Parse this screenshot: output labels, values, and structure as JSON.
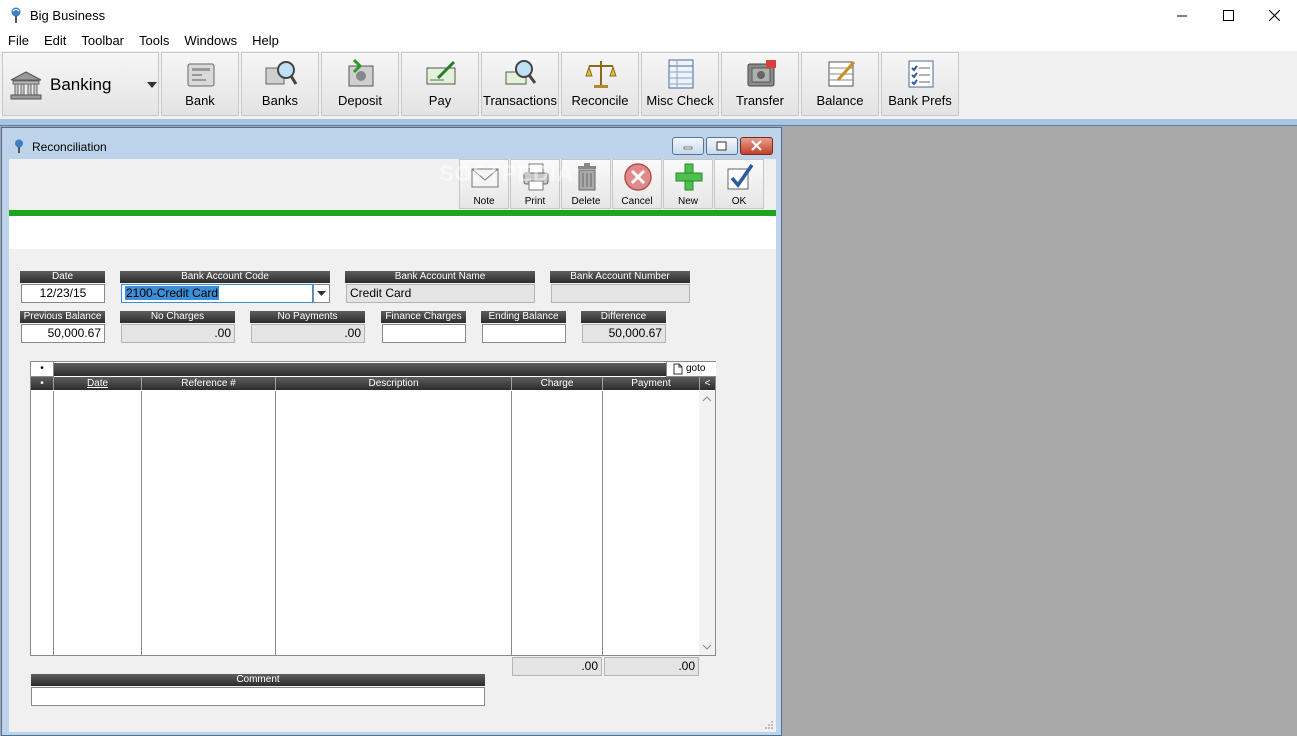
{
  "app": {
    "title": "Big Business"
  },
  "menu": [
    "File",
    "Edit",
    "Toolbar",
    "Tools",
    "Windows",
    "Help"
  ],
  "module": {
    "label": "Banking"
  },
  "toolbar": [
    {
      "label": "Bank",
      "icon": "bank-register-icon"
    },
    {
      "label": "Banks",
      "icon": "banks-search-icon"
    },
    {
      "label": "Deposit",
      "icon": "deposit-icon"
    },
    {
      "label": "Pay",
      "icon": "pay-check-icon"
    },
    {
      "label": "Transactions",
      "icon": "transactions-search-icon"
    },
    {
      "label": "Reconcile",
      "icon": "scales-icon"
    },
    {
      "label": "Misc Check",
      "icon": "ledger-icon"
    },
    {
      "label": "Transfer",
      "icon": "safe-transfer-icon"
    },
    {
      "label": "Balance",
      "icon": "balance-sheet-icon"
    },
    {
      "label": "Bank Prefs",
      "icon": "checklist-icon"
    }
  ],
  "child": {
    "title": "Reconciliation",
    "actions": [
      {
        "label": "Note"
      },
      {
        "label": "Print"
      },
      {
        "label": "Delete"
      },
      {
        "label": "Cancel"
      },
      {
        "label": "New"
      },
      {
        "label": "OK"
      }
    ],
    "watermark": "SOFTPEDIA"
  },
  "form": {
    "date": {
      "label": "Date",
      "value": "12/23/15"
    },
    "bank_account_code": {
      "label": "Bank Account Code",
      "value": "2100-Credit Card"
    },
    "bank_account_name": {
      "label": "Bank Account Name",
      "value": "Credit Card"
    },
    "bank_account_number": {
      "label": "Bank Account Number",
      "value": ""
    },
    "previous_balance": {
      "label": "Previous Balance",
      "value": "50,000.67"
    },
    "no_charges": {
      "label": "No Charges",
      "value": ".00"
    },
    "no_payments": {
      "label": "No Payments",
      "value": ".00"
    },
    "finance_charges": {
      "label": "Finance Charges",
      "value": ""
    },
    "ending_balance": {
      "label": "Ending Balance",
      "value": ""
    },
    "difference": {
      "label": "Difference",
      "value": "50,000.67"
    }
  },
  "grid": {
    "bullet": "•",
    "goto": "goto",
    "columns": [
      "•",
      "Date",
      "Reference #",
      "Description",
      "Charge",
      "Payment",
      "<"
    ],
    "totals": {
      "charge": ".00",
      "payment": ".00"
    }
  },
  "comment": {
    "label": "Comment",
    "value": ""
  }
}
